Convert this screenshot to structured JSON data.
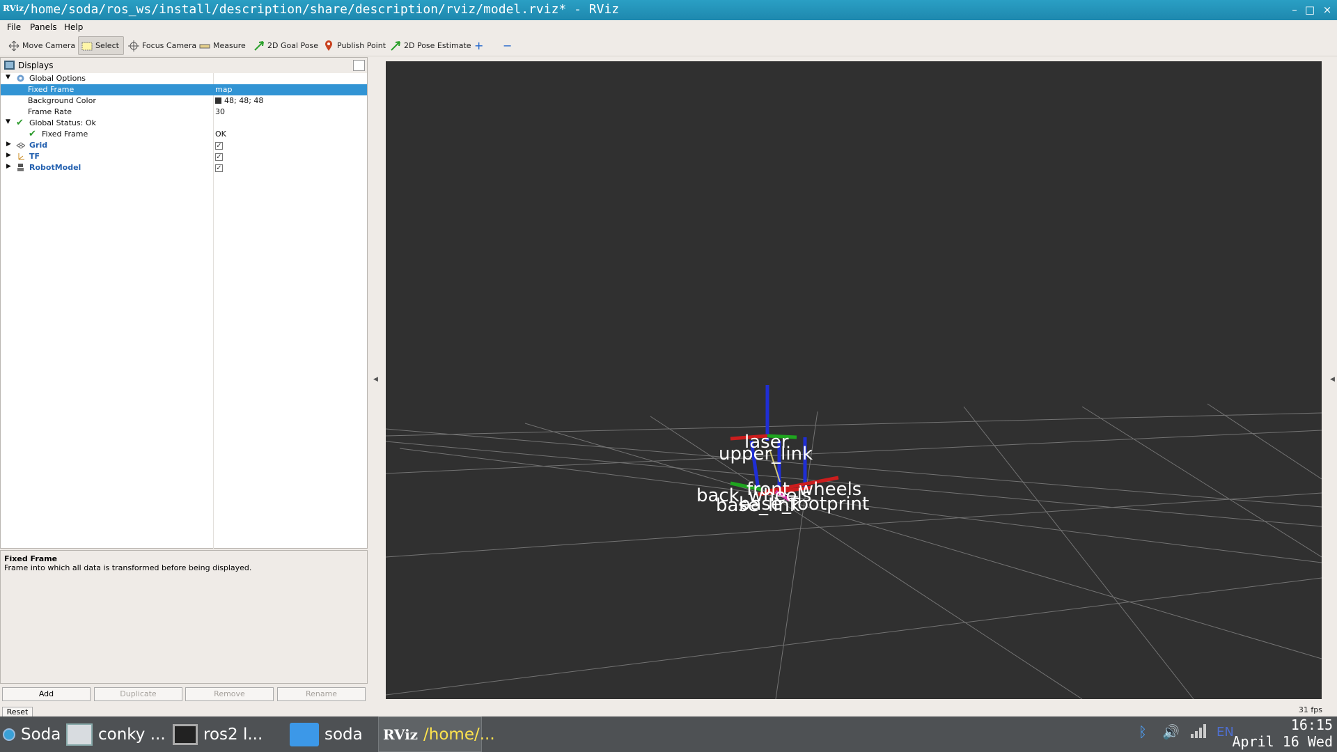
{
  "window": {
    "app_badge": "RViz",
    "title": "/home/soda/ros_ws/install/description/share/description/rviz/model.rviz* - RViz",
    "controls": {
      "minimize": "–",
      "maximize": "□",
      "close": "×"
    }
  },
  "menu": [
    "File",
    "Panels",
    "Help"
  ],
  "toolbar": {
    "move_camera": "Move Camera",
    "select": "Select",
    "focus_camera": "Focus Camera",
    "measure": "Measure",
    "goal_pose": "2D Goal Pose",
    "publish_point": "Publish Point",
    "pose_estimate": "2D Pose Estimate",
    "add_tool": "+",
    "remove_tool": "−"
  },
  "displays": {
    "title": "Displays",
    "rows": {
      "global_options": "Global Options",
      "fixed_frame": {
        "label": "Fixed Frame",
        "value": "map"
      },
      "background_color": {
        "label": "Background Color",
        "value": "48; 48; 48",
        "swatch": "#303030"
      },
      "frame_rate": {
        "label": "Frame Rate",
        "value": "30"
      },
      "global_status": "Global Status: Ok",
      "status_fixed_frame": {
        "label": "Fixed Frame",
        "value": "OK"
      },
      "grid": {
        "label": "Grid",
        "checked": "✓"
      },
      "tf": {
        "label": "TF",
        "checked": "✓"
      },
      "robot_model": {
        "label": "RobotModel",
        "checked": "✓"
      }
    },
    "buttons": {
      "add": "Add",
      "duplicate": "Duplicate",
      "remove": "Remove",
      "rename": "Rename"
    }
  },
  "help": {
    "title": "Fixed Frame",
    "text": "Frame into which all data is transformed before being displayed."
  },
  "reset": "Reset",
  "fps": "31 fps",
  "scene_labels": {
    "laser": "laser",
    "upper_link": "upper_link",
    "back_wheels": "back_wheels",
    "front_wheels": "front_wheels",
    "base_link": "base_link",
    "base_footprint": "base_footprint"
  },
  "taskbar": {
    "items": {
      "soda_menu": "Soda",
      "conky": "conky ...",
      "ros2": "ros2 l...",
      "files": "soda",
      "rviz": "/home/..."
    },
    "lang": "EN",
    "time": "16:15",
    "date": "April 16 Wed"
  },
  "colors": {
    "titlebar": "#1e88ae",
    "selection": "#3294d4",
    "viewport_bg": "#303030",
    "taskbar": "#4e5154"
  }
}
